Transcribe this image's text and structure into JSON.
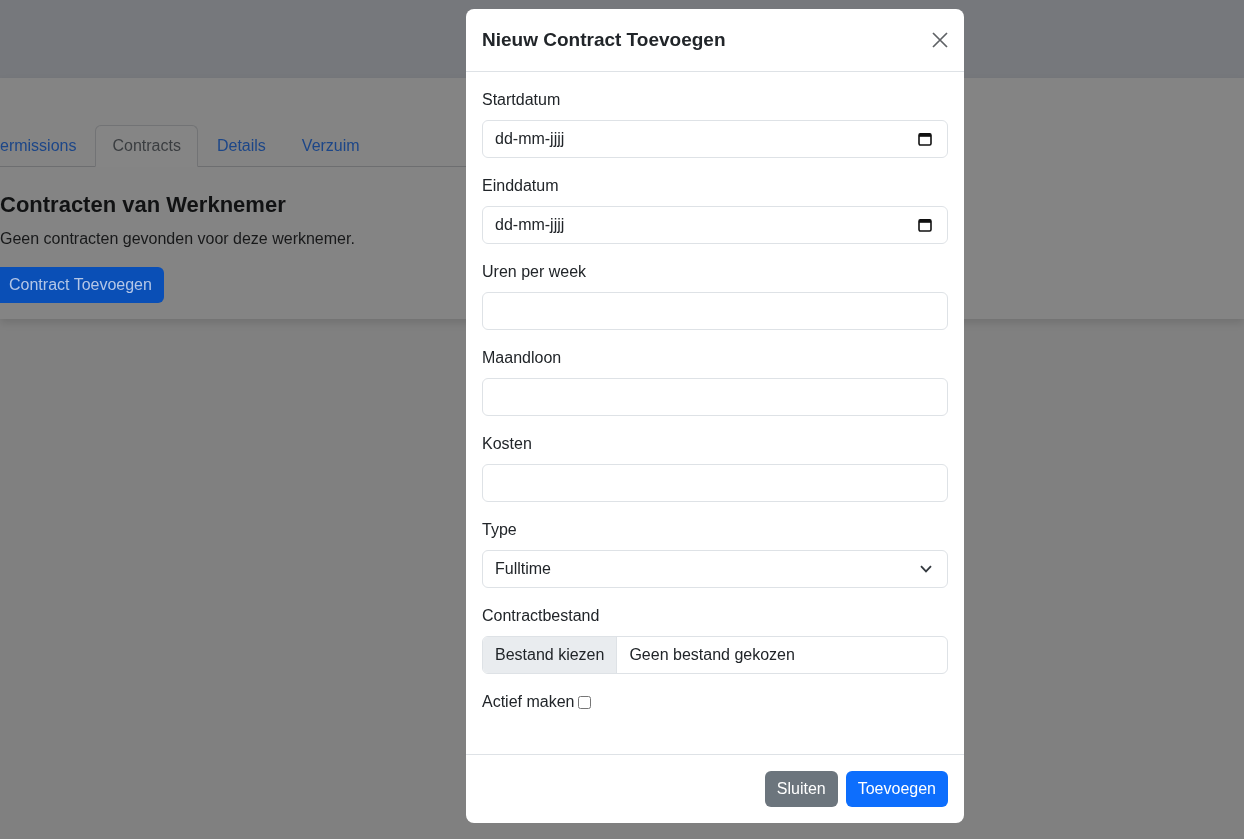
{
  "background_page": {
    "tabs": [
      {
        "label": "ermissions",
        "selected": false
      },
      {
        "label": "Contracts",
        "selected": true
      },
      {
        "label": "Details",
        "selected": false
      },
      {
        "label": "Verzuim",
        "selected": false
      }
    ],
    "heading": "Contracten van Werknemer",
    "empty_message": "Geen contracten gevonden voor deze werknemer.",
    "add_button": "Contract Toevoegen"
  },
  "modal": {
    "title": "Nieuw Contract Toevoegen",
    "fields": [
      {
        "kind": "date",
        "label": "Startdatum",
        "placeholder": "dd-mm-jjjj"
      },
      {
        "kind": "date",
        "label": "Einddatum",
        "placeholder": "dd-mm-jjjj"
      },
      {
        "kind": "text",
        "label": "Uren per week"
      },
      {
        "kind": "text",
        "label": "Maandloon"
      },
      {
        "kind": "text",
        "label": "Kosten"
      },
      {
        "kind": "select",
        "label": "Type",
        "value": "Fulltime"
      },
      {
        "kind": "file",
        "label": "Contractbestand",
        "button": "Bestand kiezen",
        "status": "Geen bestand gekozen"
      },
      {
        "kind": "checkbox",
        "label": "Actief maken",
        "checked": false
      }
    ],
    "buttons": [
      {
        "label": "Sluiten",
        "kind": "secondary"
      },
      {
        "label": "Toevoegen",
        "kind": "primary"
      }
    ]
  }
}
